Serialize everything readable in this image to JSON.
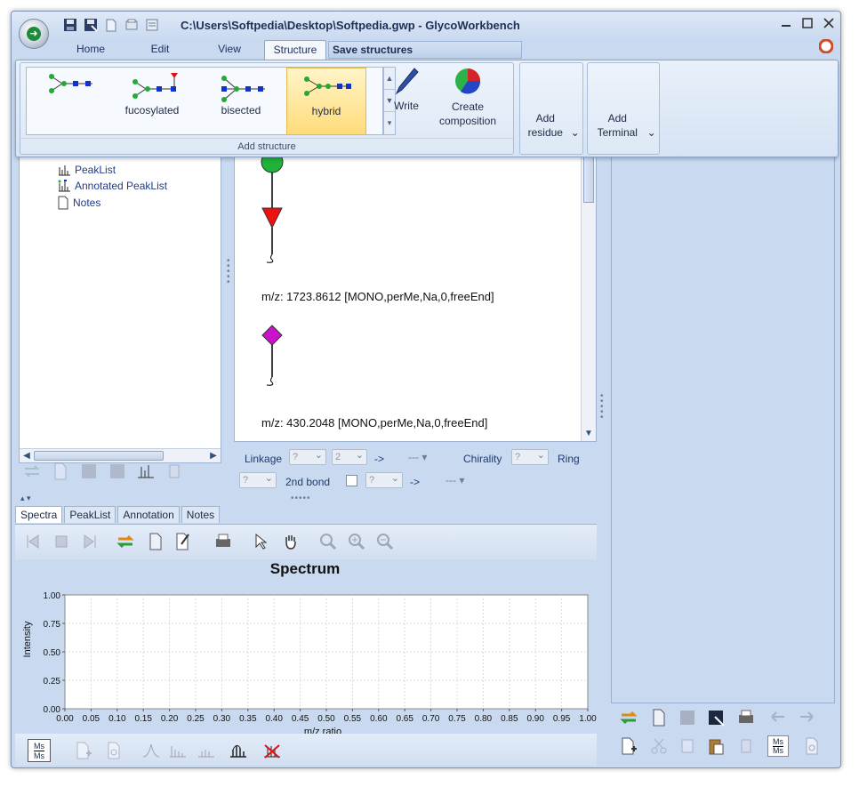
{
  "window": {
    "title": "C:\\Users\\Softpedia\\Desktop\\Softpedia.gwp - GlycoWorkbench",
    "controls": [
      "minimize",
      "maximize",
      "close"
    ]
  },
  "ribbon": {
    "tabs": [
      {
        "label": "Home",
        "active": false
      },
      {
        "label": "Edit",
        "active": false
      },
      {
        "label": "View",
        "active": false
      },
      {
        "label": "Structure",
        "active": true
      }
    ],
    "contextual_tooltip": "Save structures",
    "add_structure_group": {
      "label": "Add structure",
      "gallery": [
        {
          "label": "",
          "icon": "n-glycan-core-icon"
        },
        {
          "label": "fucosylated",
          "icon": "fucosylated-glycan-icon"
        },
        {
          "label": "bisected",
          "icon": "bisected-glycan-icon"
        },
        {
          "label": "hybrid",
          "icon": "hybrid-glycan-icon",
          "hover": true
        }
      ],
      "write_label": "Write",
      "composition_label": "Create composition"
    },
    "add_residue_label": "Add residue",
    "add_terminal_label": "Add Terminal"
  },
  "tree": {
    "items": [
      {
        "label": "PeakList",
        "icon": "peaklist-icon"
      },
      {
        "label": "Annotated PeakList",
        "icon": "annotated-peaklist-icon"
      },
      {
        "label": "Notes",
        "icon": "notes-icon"
      }
    ]
  },
  "canvas": {
    "structures": [
      {
        "mz_text": "m/z: 1723.8612 [MONO,perMe,Na,0,freeEnd]"
      },
      {
        "mz_text": "m/z: 430.2048 [MONO,perMe,Na,0,freeEnd]"
      }
    ]
  },
  "linkage": {
    "linkage_label": "Linkage",
    "arrow": "->",
    "chirality_label": "Chirality",
    "ring_label": "Ring",
    "second_bond_label": "2nd bond",
    "combo_anomer": "?",
    "combo_position": "2",
    "combo_dashes": "---",
    "combo_chirality": "?",
    "combo_ring": "?",
    "combo_2nd": "?"
  },
  "bottom_tabs": [
    {
      "label": "Spectra",
      "active": true
    },
    {
      "label": "PeakList",
      "active": false
    },
    {
      "label": "Annotation",
      "active": false
    },
    {
      "label": "Notes",
      "active": false
    }
  ],
  "chart_data": {
    "type": "line",
    "title": "Spectrum",
    "xlabel": "m/z ratio",
    "ylabel": "Intensity",
    "xlim": [
      0,
      1
    ],
    "ylim": [
      0,
      1
    ],
    "x_ticks": [
      "0.00",
      "0.05",
      "0.10",
      "0.15",
      "0.20",
      "0.25",
      "0.30",
      "0.35",
      "0.40",
      "0.45",
      "0.50",
      "0.55",
      "0.60",
      "0.65",
      "0.70",
      "0.75",
      "0.80",
      "0.85",
      "0.90",
      "0.95",
      "1.00"
    ],
    "y_ticks": [
      "0.00",
      "0.25",
      "0.50",
      "0.75",
      "1.00"
    ],
    "grid": true,
    "series": []
  },
  "icons": {
    "msms_label_top": "Ms",
    "msms_label_bottom": "Ms"
  },
  "colors": {
    "accent": "#1f3c88",
    "window_bg": "#c9daf0",
    "hover": "#ffdc7a"
  }
}
